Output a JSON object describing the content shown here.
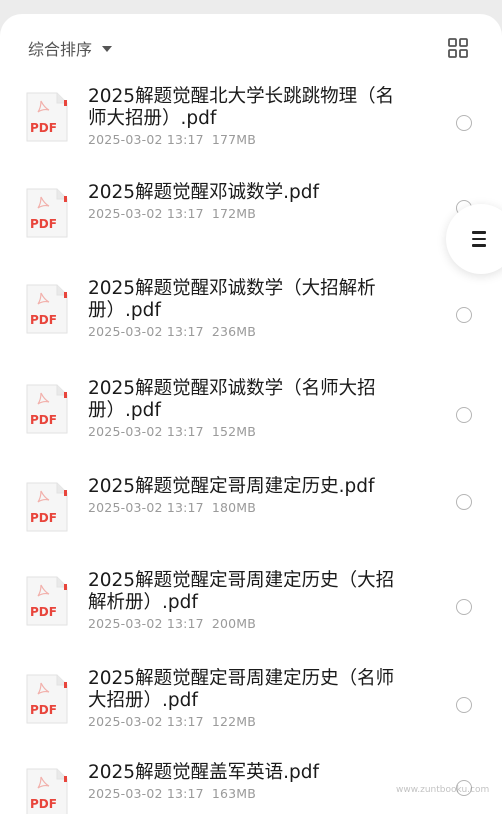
{
  "toolbar": {
    "sort_label": "综合排序",
    "grid_icon": "grid-view-icon"
  },
  "files": [
    {
      "title": "2025解题觉醒北大学长跳跳物理（名师大招册）.pdf",
      "date": "2025-03-02 13:17",
      "size": "177MB"
    },
    {
      "title": "2025解题觉醒邓诚数学.pdf",
      "date": "2025-03-02 13:17",
      "size": "172MB"
    },
    {
      "title": "2025解题觉醒邓诚数学（大招解析册）.pdf",
      "date": "2025-03-02 13:17",
      "size": "236MB"
    },
    {
      "title": "2025解题觉醒邓诚数学（名师大招册）.pdf",
      "date": "2025-03-02 13:17",
      "size": "152MB"
    },
    {
      "title": "2025解题觉醒定哥周建定历史.pdf",
      "date": "2025-03-02 13:17",
      "size": "180MB"
    },
    {
      "title": "2025解题觉醒定哥周建定历史（大招解析册）.pdf",
      "date": "2025-03-02 13:17",
      "size": "200MB"
    },
    {
      "title": "2025解题觉醒定哥周建定历史（名师大招册）.pdf",
      "date": "2025-03-02 13:17",
      "size": "122MB"
    },
    {
      "title": "2025解题觉醒盖军英语.pdf",
      "date": "2025-03-02 13:17",
      "size": "163MB"
    }
  ],
  "pdf_label": "PDF",
  "colors": {
    "pdf_red": "#e8453c",
    "pdf_bg": "#f6f6f6"
  },
  "watermark": "www.zuntbooku.com"
}
